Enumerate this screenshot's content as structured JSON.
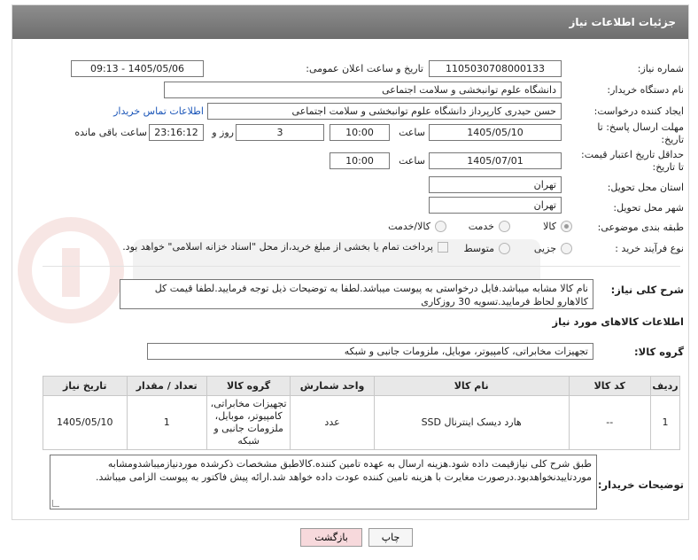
{
  "header": {
    "title": "جزئیات اطلاعات نیاز"
  },
  "form": {
    "need_number_label": "شماره نیاز:",
    "need_number": "1105030708000133",
    "announce_label": "تاریخ و ساعت اعلان عمومی:",
    "announce_value": "1405/05/06 - 09:13",
    "buyer_org_label": "نام دستگاه خریدار:",
    "buyer_org": "دانشگاه علوم توانبخشی و سلامت اجتماعی",
    "creator_label": "ایجاد کننده درخواست:",
    "creator": "حسن حیدری کارپرداز دانشگاه علوم توانبخشی و سلامت اجتماعی",
    "contact_link": "اطلاعات تماس خریدار",
    "deadline_label_1": "مهلت ارسال پاسخ: تا",
    "deadline_label_2": "تاریخ:",
    "deadline_date": "1405/05/10",
    "time_label": "ساعت",
    "deadline_time": "10:00",
    "days_value": "3",
    "days_label": "روز و",
    "remaining_value": "23:16:12",
    "remaining_label": "ساعت باقی مانده",
    "price_valid_label_1": "حداقل تاریخ اعتبار قیمت:",
    "price_valid_label_2": "تا تاریخ:",
    "price_valid_date": "1405/07/01",
    "price_valid_time": "10:00",
    "province_label": "استان محل تحویل:",
    "province": "تهران",
    "city_label": "شهر محل تحویل:",
    "city": "تهران",
    "category_label": "طبقه بندی موضوعی:",
    "category_options": [
      "کالا",
      "خدمت",
      "کالا/خدمت"
    ],
    "process_label": "نوع فرآیند خرید :",
    "process_options": [
      "جزیی",
      "متوسط"
    ],
    "payment_text": "پرداخت تمام یا بخشی از مبلغ خرید،از محل \"اسناد خزانه اسلامی\" خواهد بود."
  },
  "description": {
    "label": "شرح کلی نیاز:",
    "text": "نام کالا مشابه میباشد.فایل درخواستی به پیوست میباشد.لطفا به توضیحات ذیل توجه فرمایید.لطفا قیمت کل کالاهارو لحاظ فرمایید.تسویه 30 روزکاری"
  },
  "goods": {
    "section_title": "اطلاعات کالاهای مورد نیاز",
    "group_label": "گروه کالا:",
    "group_value": "تجهیزات مخابراتی، کامپیوتر، موبایل، ملزومات جانبی و شبکه",
    "columns": [
      "ردیف",
      "کد کالا",
      "نام کالا",
      "واحد شمارش",
      "گروه کالا",
      "تعداد / مقدار",
      "تاریخ نیاز"
    ],
    "rows": [
      {
        "index": "1",
        "code": "--",
        "name": "هارد دیسک اینترنال SSD",
        "unit": "عدد",
        "group": "تجهیزات مخابراتی، کامپیوتر، موبایل، ملزومات جانبی و شبکه",
        "qty": "1",
        "date": "1405/05/10"
      }
    ]
  },
  "buyer_notes": {
    "label": "توضیحات خریدار:",
    "text": "طبق شرح کلی نیازقیمت داده شود.هزینه ارسال به عهده تامین کننده.کالاطبق مشخصات ذکرشده موردنیازمیباشدومشابه موردتاییدنخواهدبود.درصورت مغایرت با هزینه تامین کننده عودت داده خواهد شد.ارائه پیش فاکتور به پیوست الزامی میباشد."
  },
  "buttons": {
    "print": "چاپ",
    "back": "بازگشت"
  },
  "colors": {
    "header_bg": "#7a7a7a",
    "link": "#1a55b8",
    "back_bg": "#f7d9dc"
  }
}
